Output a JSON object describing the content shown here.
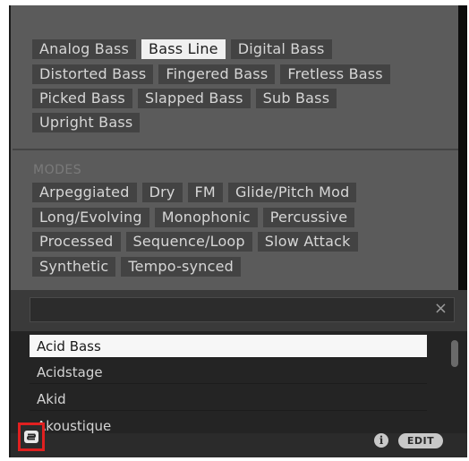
{
  "tags": {
    "bass_types": [
      {
        "label": "Analog Bass",
        "selected": false
      },
      {
        "label": "Bass Line",
        "selected": true
      },
      {
        "label": "Digital Bass",
        "selected": false
      },
      {
        "label": "Distorted Bass",
        "selected": false
      },
      {
        "label": "Fingered Bass",
        "selected": false
      },
      {
        "label": "Fretless Bass",
        "selected": false
      },
      {
        "label": "Picked Bass",
        "selected": false
      },
      {
        "label": "Slapped Bass",
        "selected": false
      },
      {
        "label": "Sub Bass",
        "selected": false
      },
      {
        "label": "Upright Bass",
        "selected": false
      }
    ],
    "modes_label": "MODES",
    "modes": [
      "Arpeggiated",
      "Dry",
      "FM",
      "Glide/Pitch Mod",
      "Long/Evolving",
      "Monophonic",
      "Percussive",
      "Processed",
      "Sequence/Loop",
      "Slow Attack",
      "Synthetic",
      "Tempo-synced"
    ]
  },
  "search": {
    "value": "",
    "placeholder": "",
    "clear_glyph": "×"
  },
  "results": [
    {
      "label": "Acid Bass",
      "selected": true
    },
    {
      "label": "Acidstage",
      "selected": false
    },
    {
      "label": "Akid",
      "selected": false
    },
    {
      "label": "Akoustique",
      "selected": false
    }
  ],
  "footer": {
    "browser_icon": "browser-toggle-icon",
    "info_label": "i",
    "edit_label": "EDIT"
  },
  "colors": {
    "highlight_border": "#e02020",
    "selected_tag_bg": "#f0f0f0",
    "tag_bg": "#434343",
    "panel_bg": "#5b5b5b"
  }
}
